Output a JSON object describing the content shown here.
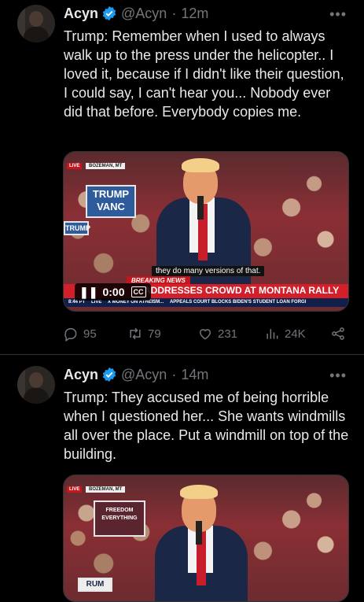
{
  "tweets": [
    {
      "name": "Acyn",
      "handle": "@Acyn",
      "separator": "·",
      "time": "12m",
      "text": "Trump: Remember when I used to always walk up to the press under the helicopter.. I loved it, because if I didn't like their question, I could say, I can't hear you... Nobody ever did that before. Everybody copies me.",
      "video": {
        "live": "LIVE",
        "location": "BOZEMAN, MT",
        "sign": "TRUMP VANC",
        "sign_left": "TRUMP",
        "subtitle": "they do many versions of that.",
        "breaking": "BREAKING NEWS",
        "headline": "ADDRESSES CROWD AT MONTANA RALLY",
        "ticker_time": "8:44 PT",
        "ticker_live": "LIVE",
        "ticker_1": "X MONEY ON ATHEISM...",
        "ticker_2": "APPEALS COURT BLOCKS BIDEN'S STUDENT LOAN FORGI",
        "play_time": "0:00",
        "cc": "CC"
      },
      "replies": "95",
      "reposts": "79",
      "likes": "231",
      "views": "24K"
    },
    {
      "name": "Acyn",
      "handle": "@Acyn",
      "separator": "·",
      "time": "14m",
      "text": "Trump: They accused me of being horrible when I questioned her... She wants windmills all over the place. Put a windmill on top of the building.",
      "video": {
        "live": "LIVE",
        "location": "BOZEMAN, MT",
        "sign": "FREEDOM EVERYTHING",
        "sign_left": "RUM"
      }
    }
  ],
  "colors": {
    "accent": "#1d9bf0",
    "muted": "#71767b",
    "text": "#e7e9ea",
    "background": "#000000"
  }
}
